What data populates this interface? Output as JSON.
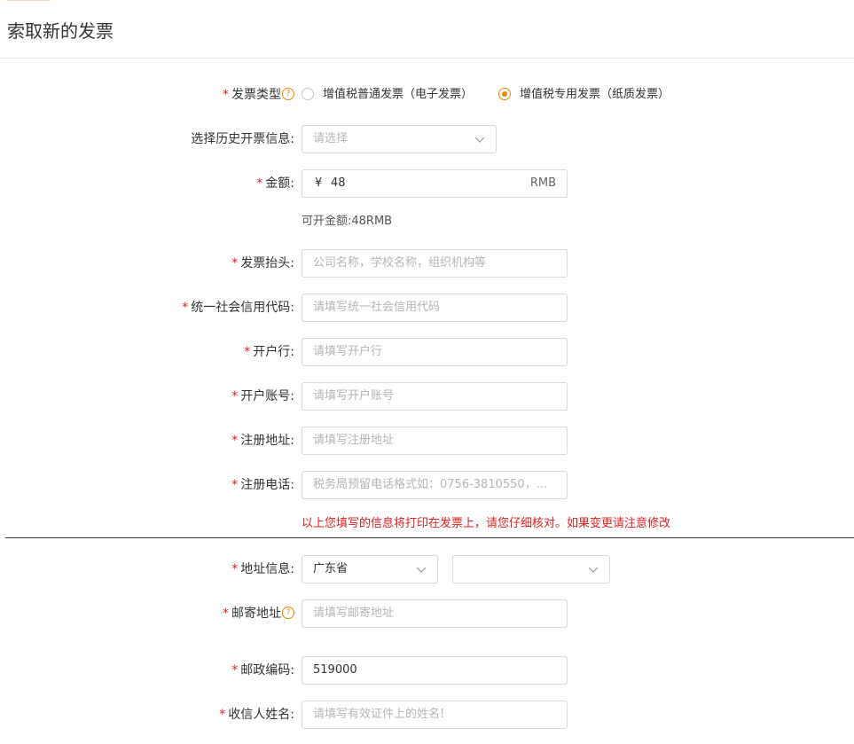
{
  "page": {
    "title": "索取新的发票"
  },
  "invoice_type": {
    "label": "发票类型",
    "options": [
      {
        "label": "增值税普通发票（电子发票）",
        "selected": false
      },
      {
        "label": "增值税专用发票（纸质发票）",
        "selected": true
      }
    ]
  },
  "history": {
    "label": "选择历史开票信息:",
    "placeholder": "请选择"
  },
  "amount": {
    "label": "金额:",
    "currency": "¥",
    "value": "48",
    "unit": "RMB",
    "available": "可开金额:48RMB"
  },
  "title_field": {
    "label": "发票抬头:",
    "placeholder": "公司名称，学校名称，组织机构等"
  },
  "credit_code": {
    "label": "统一社会信用代码:",
    "placeholder": "请填写统一社会信用代码"
  },
  "bank": {
    "label": "开户行:",
    "placeholder": "请填写开户行"
  },
  "account": {
    "label": "开户账号:",
    "placeholder": "请填写开户账号"
  },
  "reg_address": {
    "label": "注册地址:",
    "placeholder": "请填写注册地址"
  },
  "reg_phone": {
    "label": "注册电话:",
    "placeholder": "税务局预留电话格式如：0756-3810550，..."
  },
  "warning": "以上您填写的信息将打印在发票上，请您仔细核对。如果变更请注意修改",
  "address_info": {
    "label": "地址信息:",
    "province": "广东省",
    "city": ""
  },
  "mail_address": {
    "label": "邮寄地址",
    "placeholder": "请填写邮寄地址"
  },
  "postcode": {
    "label": "邮政编码:",
    "value": "519000"
  },
  "recipient": {
    "label": "收信人姓名:",
    "placeholder": "请填写有效证件上的姓名!"
  },
  "colors": {
    "accent": "#f08300",
    "required": "#e02020",
    "border": "#d9d9d9"
  },
  "icons": {
    "help": "help-circle-icon",
    "dropdown": "chevron-down-icon"
  }
}
